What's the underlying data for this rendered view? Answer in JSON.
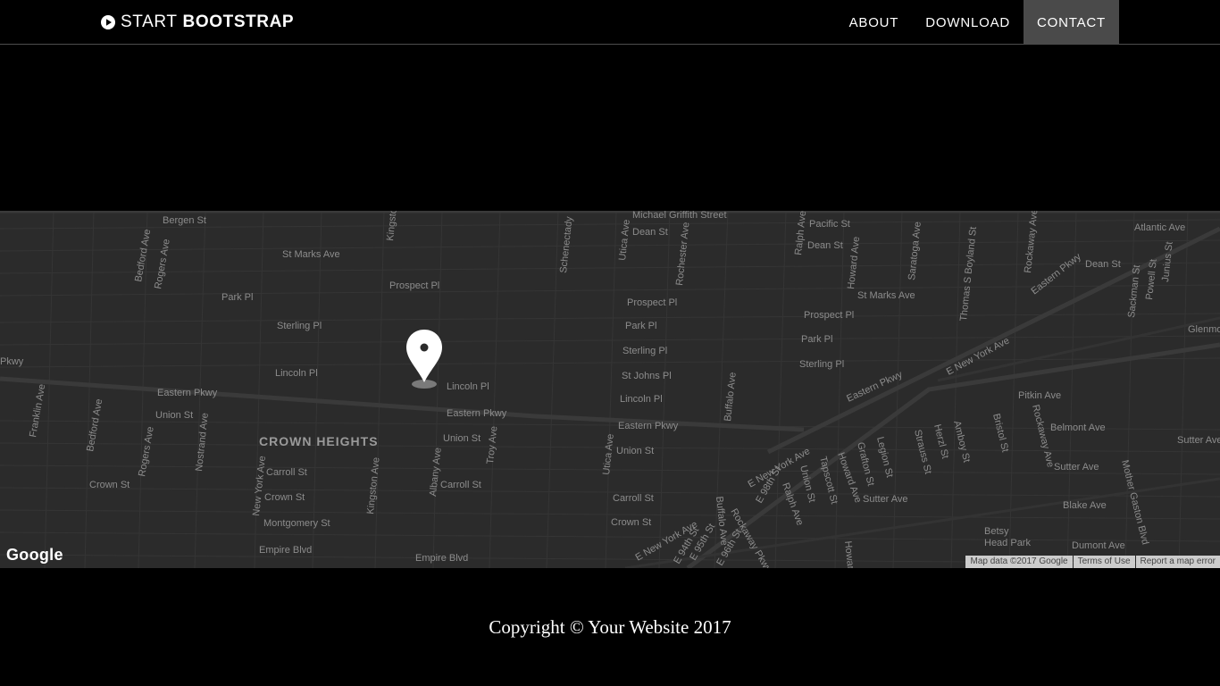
{
  "nav": {
    "brand_light": "START",
    "brand_bold": "BOOTSTRAP",
    "links": [
      "ABOUT",
      "DOWNLOAD",
      "CONTACT"
    ],
    "active_link": "CONTACT"
  },
  "map": {
    "neighborhood": "CROWN HEIGHTS",
    "streets": [
      "Bergen St",
      "Michael Griffith Street",
      "Dean St",
      "Pacific St",
      "Atlantic Ave",
      "St Marks Ave",
      "Prospect Pl",
      "Park Pl",
      "Sterling Pl",
      "Lincoln Pl",
      "Eastern Pkwy",
      "Union St",
      "Carroll St",
      "Crown St",
      "Montgomery St",
      "Empire Blvd",
      "St Johns Pl",
      "Bedford Ave",
      "Rogers Ave",
      "Nostrand Ave",
      "New York Ave",
      "Kingston Ave",
      "Albany Ave",
      "Troy Ave",
      "Schenectady",
      "Utica Ave",
      "Rochester Ave",
      "Buffalo Ave",
      "Ralph Ave",
      "Howard Ave",
      "Saratoga Ave",
      "Thomas S Boyland St",
      "Rockaway Ave",
      "Junius St",
      "Powell St",
      "Sackman St",
      "Glenmore",
      "E New York Ave",
      "Pitkin Ave",
      "Belmont Ave",
      "Sutter Ave",
      "Blake Ave",
      "Dumont Ave",
      "Mother Gaston Blvd",
      "Betsy Head Park",
      "Franklin Ave",
      "Grafton St",
      "Legion St",
      "Strauss St",
      "Herzl St",
      "Amboy St",
      "Bristol St",
      "Tapscott St",
      "E 98th St",
      "E 95th St",
      "E 94th St",
      "E 96th St",
      "Rockaway Pkwy"
    ],
    "logo": "Google",
    "attribution": [
      "Map data ©2017 Google",
      "Terms of Use",
      "Report a map error"
    ]
  },
  "footer": {
    "copyright": "Copyright © Your Website 2017"
  },
  "colors": {
    "background": "#000000",
    "map_background": "#2b2b2b",
    "nav_active": "#4a4a4a"
  }
}
